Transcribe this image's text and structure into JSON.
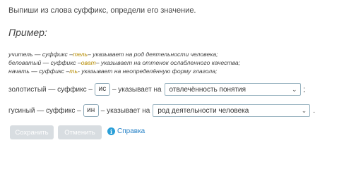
{
  "instruction": "Выпиши из слова суффикс, определи его значение.",
  "example_heading": "Пример:",
  "example_lines": [
    {
      "pre": "учитель — суффикс –",
      "suffix": "тель",
      "post": "– указывает на род деятельности человека;"
    },
    {
      "pre": "беловатый — суффикс –",
      "suffix": "оват",
      "post": "– указывает на оттенок ослабленного качества;"
    },
    {
      "pre": "начать — суффикс –",
      "suffix": "ть",
      "post": "- указывает на неопределённую форму глагола;"
    }
  ],
  "rows": [
    {
      "word_text": "золотистый — суффикс –",
      "answer": "ис",
      "between": "– указывает на",
      "selected": "отвлечённость понятия",
      "end": ";"
    },
    {
      "word_text": "гусиный — суффикс –",
      "answer": "ин",
      "between": "– указывает на",
      "selected": "род деятельности человека",
      "end": "."
    }
  ],
  "buttons": {
    "save": "Сохранить",
    "cancel": "Отменить"
  },
  "help": {
    "label": "Справка",
    "icon": "info-icon"
  },
  "colors": {
    "suffix_highlight": "#b58b00",
    "button_disabled": "#d8dde1",
    "help_link": "#2a84c8"
  }
}
